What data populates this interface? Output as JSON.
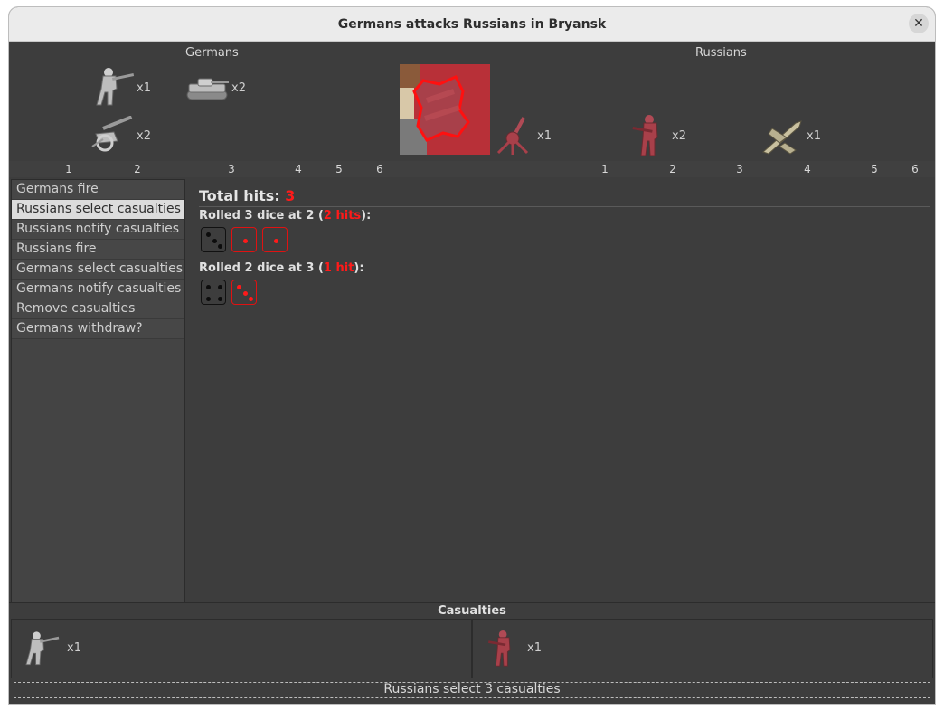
{
  "window": {
    "title": "Germans attacks Russians in Bryansk"
  },
  "attacker": {
    "name": "Germans",
    "units": [
      {
        "icon": "infantry-icon",
        "count": "x1"
      },
      {
        "icon": "tank-icon",
        "count": "x2"
      },
      {
        "icon": "artillery-icon",
        "count": "x2"
      }
    ]
  },
  "defender": {
    "name": "Russians",
    "units": [
      {
        "icon": "aa-gun-icon",
        "count": "x1"
      },
      {
        "icon": "infantry-icon",
        "count": "x2"
      },
      {
        "icon": "fighter-icon",
        "count": "x1"
      }
    ]
  },
  "positions_left": [
    "1",
    "2",
    "3",
    "4",
    "5",
    "6"
  ],
  "positions_right": [
    "1",
    "2",
    "3",
    "4",
    "5",
    "6"
  ],
  "steps": [
    "Germans fire",
    "Russians select casualties",
    "Russians notify casualties",
    "Russians fire",
    "Germans select casualties",
    "Germans notify casualties",
    "Remove casualties",
    "Germans withdraw?"
  ],
  "selected_step": "Russians select casualties",
  "results": {
    "total_label": "Total hits: ",
    "total_value": "3",
    "rolls": [
      {
        "prefix": "Rolled 3 dice at 2 (",
        "hits": "2 hits",
        "suffix": "):",
        "dice": [
          3,
          1,
          1
        ]
      },
      {
        "prefix": "Rolled 2 dice at 3 (",
        "hits": "1 hit",
        "suffix": "):",
        "dice": [
          4,
          3
        ]
      }
    ]
  },
  "casualties": {
    "title": "Casualties",
    "attacker": {
      "icon": "infantry-icon",
      "count": "x1"
    },
    "defender": {
      "icon": "infantry-icon",
      "count": "x1"
    }
  },
  "status": "Russians select 3 casualties",
  "colors": {
    "german": "#c8c8c8",
    "russian": "#a8404a",
    "hit": "#ff1a1a",
    "background": "#3d3d3d"
  }
}
